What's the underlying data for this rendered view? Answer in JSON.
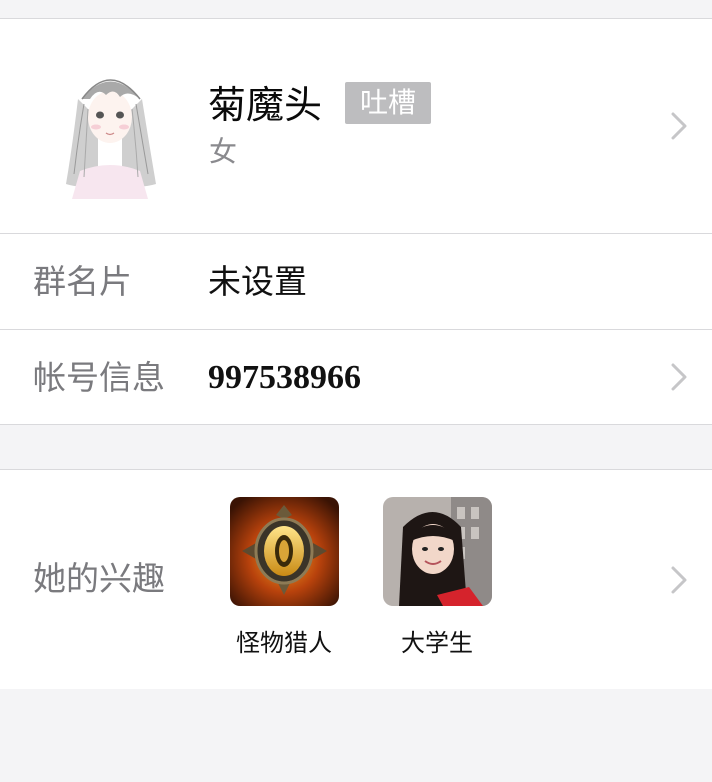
{
  "profile": {
    "name": "菊魔头",
    "tag": "吐槽",
    "gender": "女",
    "avatar_icon": "girl-sketch-avatar"
  },
  "rows": [
    {
      "label": "群名片",
      "value": "未设置"
    },
    {
      "label": "帐号信息",
      "value": "997538966"
    }
  ],
  "interests": {
    "label": "她的兴趣",
    "items": [
      {
        "caption": "怪物猎人",
        "icon": "monster-hunter-emblem"
      },
      {
        "caption": "大学生",
        "icon": "student-photo"
      }
    ]
  },
  "colors": {
    "background": "#f4f4f6",
    "tag_bg": "#bdbdbf",
    "label_text": "#7a7a7e",
    "divider": "#d9d9dc",
    "chevron": "#c6c6c8"
  }
}
